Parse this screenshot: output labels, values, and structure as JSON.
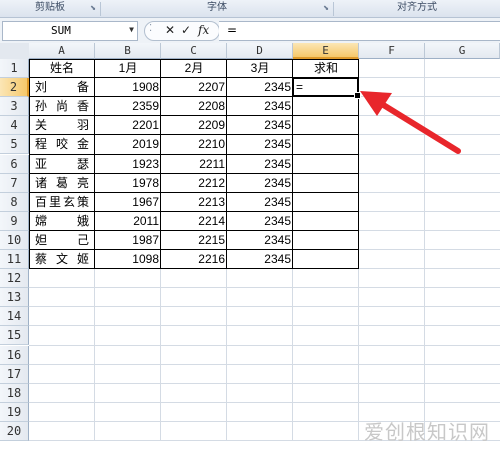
{
  "ribbon": {
    "groups": [
      {
        "label": "剪贴板"
      },
      {
        "label": "字体"
      },
      {
        "label": "对齐方式"
      }
    ]
  },
  "formula_bar": {
    "name_box": "SUM",
    "cancel_icon": "✕",
    "enter_icon": "✓",
    "fx_label": "fx",
    "formula": "="
  },
  "columns": [
    "A",
    "B",
    "C",
    "D",
    "E",
    "F",
    "G"
  ],
  "selected_column": "E",
  "rows": [
    "1",
    "2",
    "3",
    "4",
    "5",
    "6",
    "7",
    "8",
    "9",
    "10",
    "11",
    "12",
    "13",
    "14",
    "15",
    "16",
    "17",
    "18",
    "19",
    "20"
  ],
  "selected_row": "2",
  "table": {
    "headers": [
      "姓名",
      "1月",
      "2月",
      "3月",
      "求和"
    ],
    "records": [
      {
        "name": "刘备",
        "jan": "1908",
        "feb": "2207",
        "mar": "2345",
        "sum": "="
      },
      {
        "name": "孙尚香",
        "jan": "2359",
        "feb": "2208",
        "mar": "2345",
        "sum": ""
      },
      {
        "name": "关羽",
        "jan": "2201",
        "feb": "2209",
        "mar": "2345",
        "sum": ""
      },
      {
        "name": "程咬金",
        "jan": "2019",
        "feb": "2210",
        "mar": "2345",
        "sum": ""
      },
      {
        "name": "亚瑟",
        "jan": "1923",
        "feb": "2211",
        "mar": "2345",
        "sum": ""
      },
      {
        "name": "诸葛亮",
        "jan": "1978",
        "feb": "2212",
        "mar": "2345",
        "sum": ""
      },
      {
        "name": "百里玄策",
        "jan": "1967",
        "feb": "2213",
        "mar": "2345",
        "sum": ""
      },
      {
        "name": "嫦娥",
        "jan": "2011",
        "feb": "2214",
        "mar": "2345",
        "sum": ""
      },
      {
        "name": "妲己",
        "jan": "1987",
        "feb": "2215",
        "mar": "2345",
        "sum": ""
      },
      {
        "name": "蔡文姬",
        "jan": "1098",
        "feb": "2216",
        "mar": "2345",
        "sum": ""
      }
    ]
  },
  "annotation_color": "#e8262b",
  "watermark": "爱创根知识网"
}
